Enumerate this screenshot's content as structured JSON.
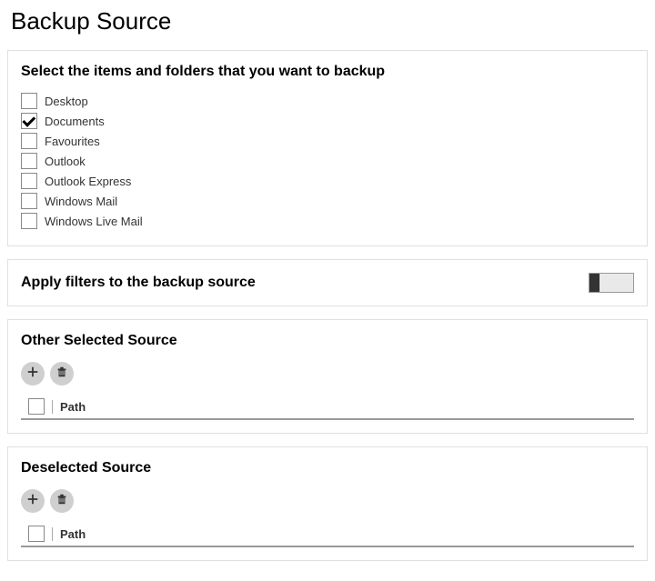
{
  "page_title": "Backup Source",
  "select_panel": {
    "title": "Select the items and folders that you want to backup",
    "items": [
      {
        "label": "Desktop",
        "checked": false
      },
      {
        "label": "Documents",
        "checked": true
      },
      {
        "label": "Favourites",
        "checked": false
      },
      {
        "label": "Outlook",
        "checked": false
      },
      {
        "label": "Outlook Express",
        "checked": false
      },
      {
        "label": "Windows Mail",
        "checked": false
      },
      {
        "label": "Windows Live Mail",
        "checked": false
      }
    ]
  },
  "filter_panel": {
    "title": "Apply filters to the backup source",
    "enabled": false
  },
  "other_source": {
    "title": "Other Selected Source",
    "path_header": "Path"
  },
  "deselected_source": {
    "title": "Deselected Source",
    "path_header": "Path"
  }
}
